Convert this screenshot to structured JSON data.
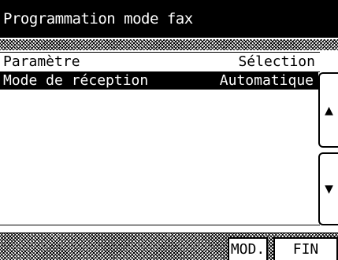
{
  "title": "Programmation mode fax",
  "columns": {
    "param": "Paramètre",
    "selection": "Sélection"
  },
  "rows": [
    {
      "param": "Mode de réception",
      "value": "Automatique",
      "selected": true
    }
  ],
  "scroll": {
    "up_icon": "▲",
    "down_icon": "▼"
  },
  "softkeys": {
    "mod": "MOD.",
    "fin": "FIN"
  }
}
